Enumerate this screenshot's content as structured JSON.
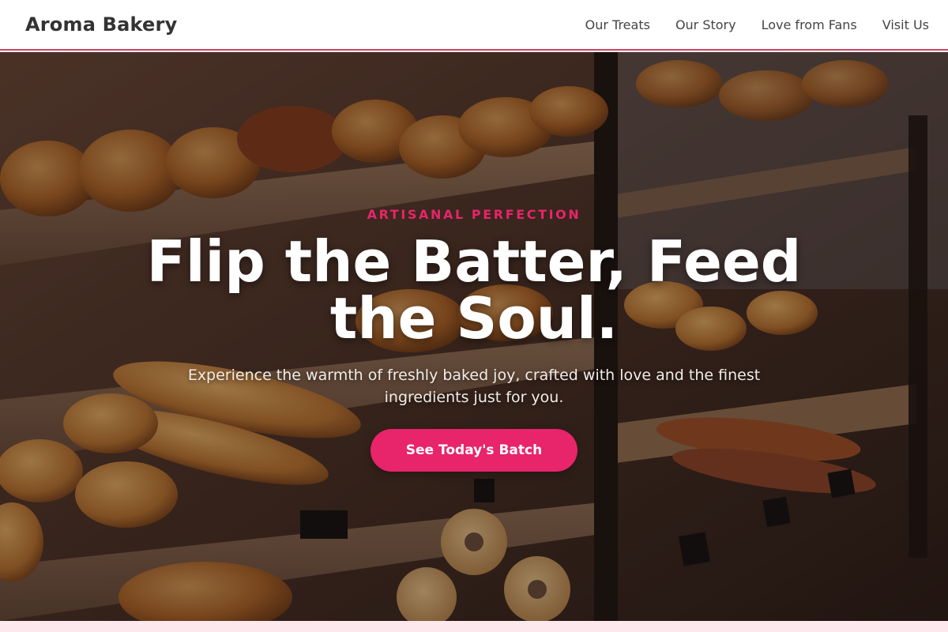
{
  "navbar": {
    "brand": "Aroma Bakery",
    "links": [
      "Our Treats",
      "Our Story",
      "Love from Fans",
      "Visit Us"
    ]
  },
  "hero": {
    "eyebrow": "ARTISANAL PERFECTION",
    "headline": "Flip the Batter, Feed the Soul.",
    "subtitle": "Experience the warmth of freshly baked joy, crafted with love and the finest ingredients just for you.",
    "cta_label": "See Today's Batch"
  },
  "colors": {
    "accent": "#e8246b",
    "nav_border": "#c84a63",
    "section_bg": "#fde8ee"
  }
}
